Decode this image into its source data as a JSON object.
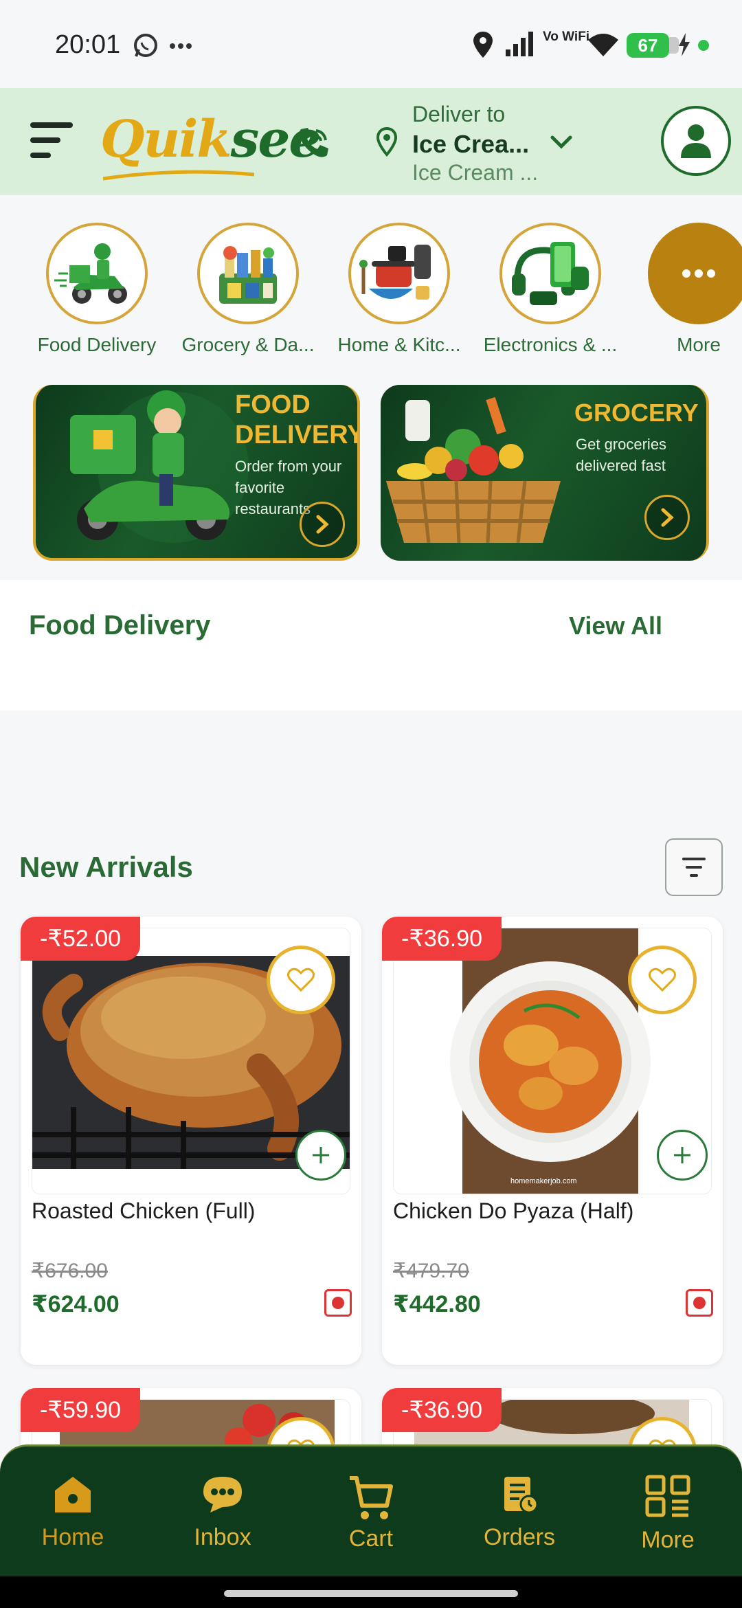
{
  "status": {
    "time": "20:01",
    "battery": "67",
    "vowifi": "Vo WiFi"
  },
  "header": {
    "logo_first": "Quik",
    "logo_second": "see",
    "deliver_label": "Deliver to",
    "deliver_name": "Ice Crea...",
    "deliver_address": "Ice Cream ..."
  },
  "categories": [
    {
      "label": "Food Delivery",
      "icon": "scooter-delivery-image"
    },
    {
      "label": "Grocery & Da...",
      "icon": "grocery-basket-image"
    },
    {
      "label": "Home & Kitc...",
      "icon": "kitchenware-image"
    },
    {
      "label": "Electronics & ...",
      "icon": "electronics-image"
    },
    {
      "label": "More",
      "icon": "more-dots-icon"
    }
  ],
  "banners": [
    {
      "title_line1": "FOOD",
      "title_line2": "DELIVERY",
      "subtitle_line1": "Order from your",
      "subtitle_line2": "favorite restaurants"
    },
    {
      "title_line1": "GROCERY",
      "subtitle_line1": "Get groceries",
      "subtitle_line2": "delivered fast"
    }
  ],
  "food_delivery_section": {
    "title": "Food Delivery",
    "view_all": "View All"
  },
  "new_arrivals": {
    "title": "New Arrivals",
    "products": [
      {
        "discount": "-₹52.00",
        "name": "Roasted Chicken (Full)",
        "old_price": "₹676.00",
        "price": "₹624.00"
      },
      {
        "discount": "-₹36.90",
        "name": "Chicken Do Pyaza (Half)",
        "old_price": "₹479.70",
        "price": "₹442.80",
        "watermark": "homemakerjob.com"
      },
      {
        "discount": "-₹59.90"
      },
      {
        "discount": "-₹36.90"
      }
    ]
  },
  "bottom_nav": [
    {
      "label": "Home",
      "icon": "home-icon",
      "active": true
    },
    {
      "label": "Inbox",
      "icon": "chat-bubble-icon"
    },
    {
      "label": "Cart",
      "icon": "cart-icon"
    },
    {
      "label": "Orders",
      "icon": "orders-icon"
    },
    {
      "label": "More",
      "icon": "grid-icon"
    }
  ],
  "colors": {
    "brand_green": "#1f6b2c",
    "brand_gold": "#e2a816",
    "discount_red": "#f03c3c",
    "nav_bg": "#0e3b1c"
  }
}
